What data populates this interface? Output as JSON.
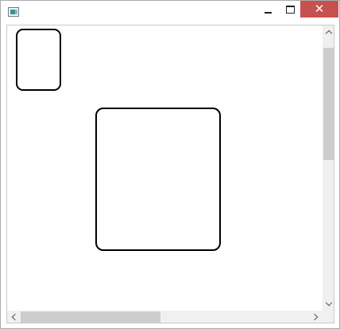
{
  "window": {
    "title": "",
    "icon": "app-window-icon",
    "controls": {
      "minimize_icon": "minimize-icon",
      "maximize_icon": "maximize-icon",
      "close_icon": "close-icon",
      "close_glyph": "✕",
      "close_color": "#c75050"
    }
  },
  "canvas": {
    "shapes": [
      {
        "name": "rounded-rectangle-small",
        "kind": "rounded-rectangle",
        "stroke": "#000000"
      },
      {
        "name": "rounded-rectangle-large",
        "kind": "rounded-rectangle",
        "stroke": "#000000"
      }
    ]
  },
  "scrollbars": {
    "vertical": {
      "up_icon": "chevron-up-icon",
      "down_icon": "chevron-down-icon",
      "position": 0.0
    },
    "horizontal": {
      "left_icon": "chevron-left-icon",
      "right_icon": "chevron-right-icon",
      "position": 0.0
    }
  }
}
